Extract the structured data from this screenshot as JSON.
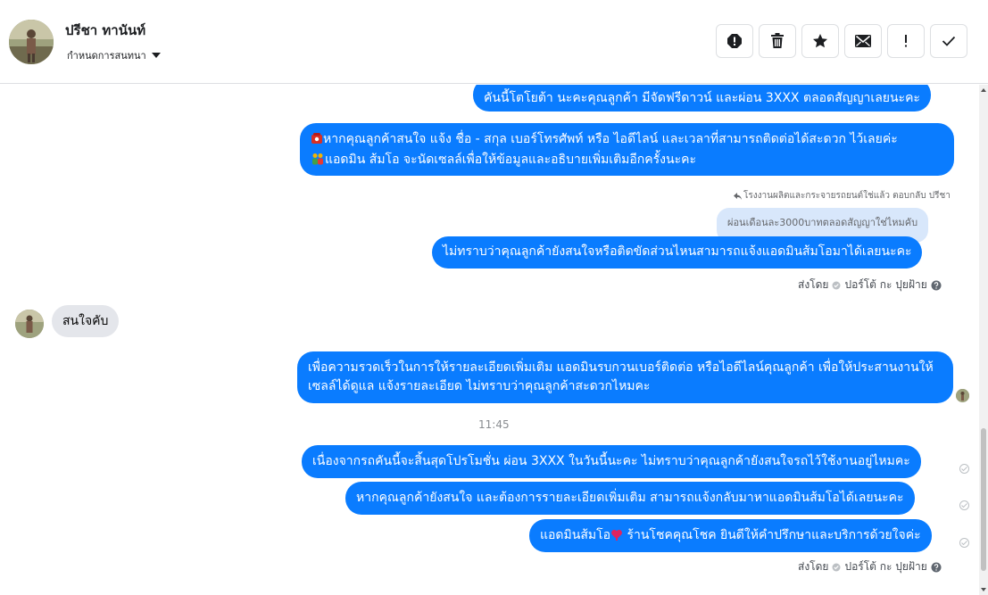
{
  "header": {
    "contact_name": "ปรีชา ทานันท์",
    "conversation_settings_label": "กำหนดการสนทนา",
    "toolbar": [
      {
        "name": "report-spam-button",
        "icon": "alert-circle-icon"
      },
      {
        "name": "delete-button",
        "icon": "trash-icon"
      },
      {
        "name": "star-button",
        "icon": "star-icon"
      },
      {
        "name": "mark-unread-button",
        "icon": "envelope-icon"
      },
      {
        "name": "flag-button",
        "icon": "exclamation-icon"
      },
      {
        "name": "mark-done-button",
        "icon": "check-icon"
      }
    ]
  },
  "messages": {
    "m1": "คันนี้โตโยต้า นะคะคุณลูกค้า มีจัดฟรีดาวน์ และผ่อน 3XXX ตลอดสัญญาเลยนะคะ",
    "m2_line1": "หากคุณลูกค้าสนใจ แจ้ง ชื่อ - สกุล เบอร์โทรศัพท์ หรือ ไอดีไลน์ และเวลาที่สามารถติดต่อได้สะดวก ไว้เลยค่ะ",
    "m2_line2": "แอดมิน ส้มโอ จะนัดเซลล์เพื่อให้ข้อมูลและอธิบายเพิ่มเติมอีกครั้งนะคะ",
    "reply_meta": "โรงงานผลิตและกระจายรถยนต์ใช่แล้ว ตอบกลับ ปรีชา",
    "reply_quote": "ผ่อนเดือนละ3000บาทตลอดสัญญาใช่ไหมคับ",
    "m3": "ไม่ทราบว่าคุณลูกค้ายังสนใจหรือติดขัดส่วนไหนสามารถแจ้งแอดมินส้มโอมาได้เลยนะคะ",
    "sent_by_1": "ส่งโดย",
    "sent_by_name_1": "ปอร์โต้ กะ ปุยฝ้าย",
    "incoming": "สนใจคับ",
    "m4": "เพื่อความรวดเร็วในการให้รายละเอียดเพิ่มเติม แอดมินรบกวนเบอร์ติดต่อ หรือไอดีไลน์คุณลูกค้า เพื่อให้ประสานงานให้เซลล์ได้ดูแล แจ้งรายละเอียด ไม่ทราบว่าคุณลูกค้าสะดวกไหมคะ",
    "timestamp": "11:45",
    "m5": "เนื่องจากรถคันนี้จะสิ้นสุดโปรโมชั่น ผ่อน 3XXX ในวันนี้นะคะ ไม่ทราบว่าคุณลูกค้ายังสนใจรถไว้ใช้งานอยู่ไหมคะ",
    "m6": "หากคุณลูกค้ายังสนใจ และต้องการรายละเอียดเพิ่มเติม สามารถแจ้งกลับมาหาแอดมินส้มโอได้เลยนะคะ",
    "m7_part1": "แอดมินส้มโอ",
    "m7_part2": " ร้านโชคคุณโชค ยินดีให้คำปรึกษาและบริการด้วยใจค่ะ",
    "sent_by_2": "ส่งโดย",
    "sent_by_name_2": "ปอร์โต้ กะ ปุยฝ้าย"
  },
  "colors": {
    "outgoing_bubble": "#0a7cff",
    "incoming_bubble": "#e4e6eb",
    "reply_bubble": "#d8e7fb"
  }
}
